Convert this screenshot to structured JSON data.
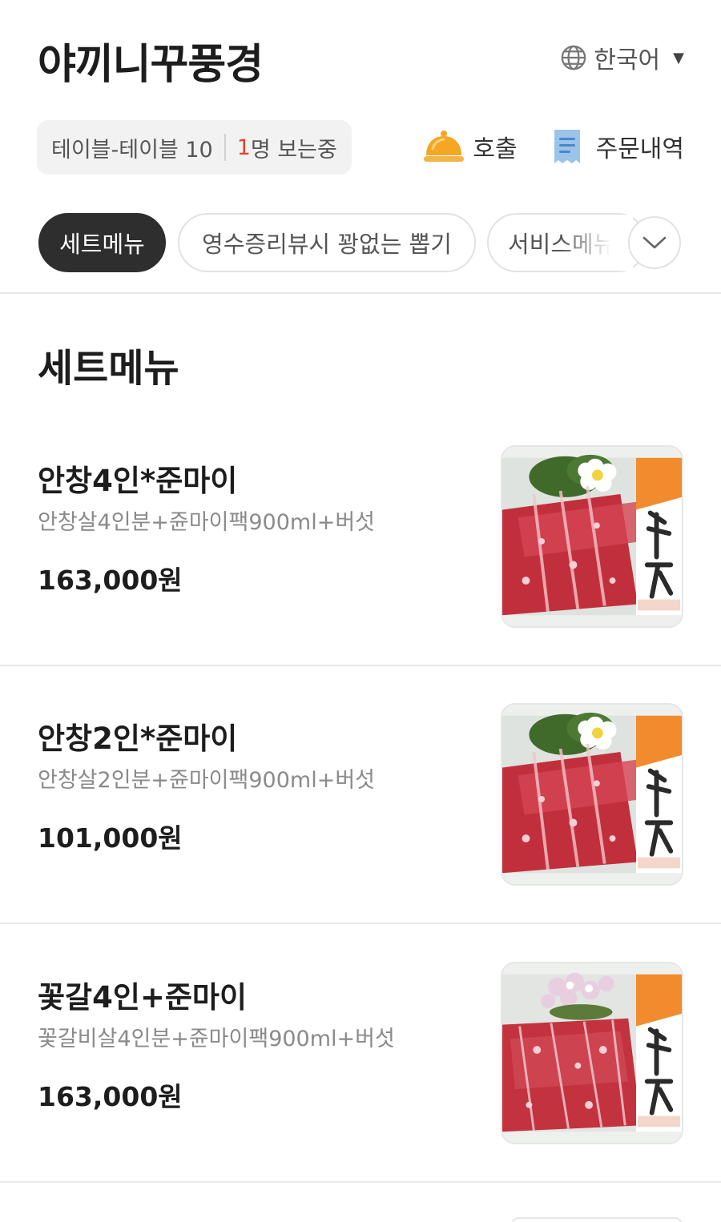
{
  "header": {
    "store_name": "야끼니꾸풍경",
    "language": "한국어"
  },
  "table_info": {
    "table_label": "테이블-테이블 10",
    "viewer_count": "1",
    "viewer_suffix": "명 보는중"
  },
  "actions": {
    "call_label": "호출",
    "orders_label": "주문내역"
  },
  "tabs": [
    {
      "label": "세트메뉴",
      "active": true
    },
    {
      "label": "영수증리뷰시 꽝없는 뽑기",
      "active": false
    },
    {
      "label": "서비스메뉴",
      "active": false
    }
  ],
  "section": {
    "title": "세트메뉴"
  },
  "items": [
    {
      "name": "안창4인*준마이",
      "description": "안창살4인분+쥰마이팩900ml+버섯",
      "price": "163,000원",
      "image": "beef-platter-with-sake-pack"
    },
    {
      "name": "안창2인*준마이",
      "description": "안창살2인분+쥰마이팩900ml+버섯",
      "price": "101,000원",
      "image": "beef-platter-with-sake-pack"
    },
    {
      "name": "꽃갈4인+준마이",
      "description": "꽃갈비살4인분+쥰마이팩900ml+버섯",
      "price": "163,000원",
      "image": "beef-platter-with-sake-pack"
    }
  ],
  "colors": {
    "accent": "#e0462b",
    "active_tab": "#2e2e2e",
    "bell": "#f5a623",
    "receipt": "#9cc3ea"
  }
}
